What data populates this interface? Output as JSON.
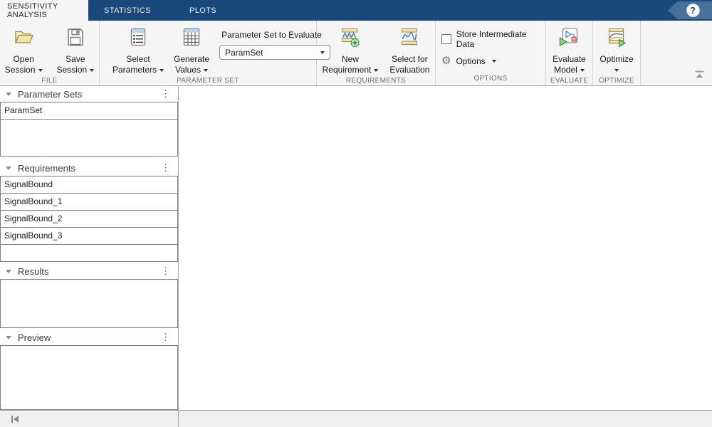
{
  "tab_bar": {
    "tabs": [
      {
        "label": "SENSITIVITY ANALYSIS",
        "active": true
      },
      {
        "label": "STATISTICS",
        "active": false
      },
      {
        "label": "PLOTS",
        "active": false
      }
    ],
    "help_tooltip": "?"
  },
  "toolbar": {
    "file": {
      "section_label": "FILE",
      "open_session": {
        "line1": "Open",
        "line2": "Session"
      },
      "save_session": {
        "line1": "Save",
        "line2": "Session"
      }
    },
    "parameter_set": {
      "section_label": "PARAMETER SET",
      "select_parameters": {
        "line1": "Select",
        "line2": "Parameters"
      },
      "generate_values": {
        "line1": "Generate",
        "line2": "Values"
      },
      "evaluate_label": "Parameter Set to Evaluate",
      "combo_value": "ParamSet"
    },
    "requirements": {
      "section_label": "REQUIREMENTS",
      "new_requirement": {
        "line1": "New",
        "line2": "Requirement"
      },
      "select_for_evaluation": {
        "line1": "Select for",
        "line2": "Evaluation"
      }
    },
    "options": {
      "section_label": "OPTIONS",
      "store_intermediate_label": "Store Intermediate Data",
      "store_intermediate_checked": false,
      "options_label": "Options"
    },
    "evaluate": {
      "section_label": "EVALUATE",
      "evaluate_model": {
        "line1": "Evaluate",
        "line2": "Model"
      }
    },
    "optimize": {
      "section_label": "OPTIMIZE",
      "optimize_label": "Optimize"
    }
  },
  "panels": {
    "parameter_sets": {
      "title": "Parameter Sets",
      "items": [
        "ParamSet"
      ]
    },
    "requirements": {
      "title": "Requirements",
      "items": [
        "SignalBound",
        "SignalBound_1",
        "SignalBound_2",
        "SignalBound_3"
      ]
    },
    "results": {
      "title": "Results",
      "items": []
    },
    "preview": {
      "title": "Preview"
    }
  },
  "colors": {
    "tab_bar": "#19497B",
    "toolbar_bg": "#F5F5F5",
    "accent_blue": "#3B7CC4",
    "icon_yellow": "#F2E3A9",
    "icon_green": "#8FD98F"
  }
}
